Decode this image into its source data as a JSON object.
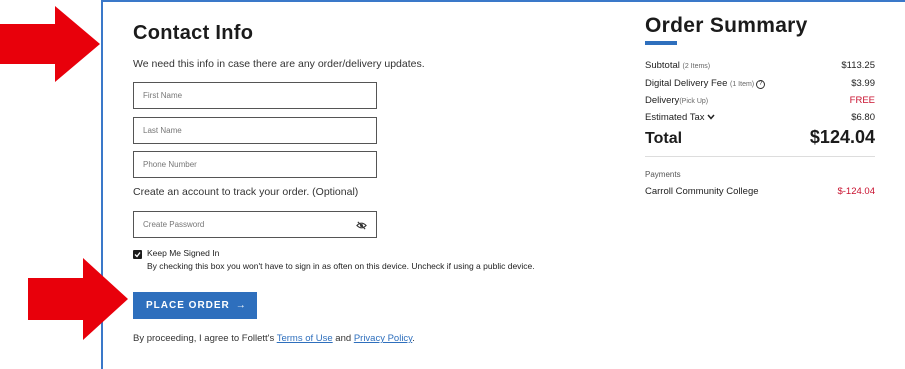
{
  "contact": {
    "title": "Contact Info",
    "subtitle": "We need this info in case there are any order/delivery updates.",
    "first_name_placeholder": "First Name",
    "last_name_placeholder": "Last Name",
    "phone_placeholder": "Phone Number",
    "create_account_text": "Create an account to track your order. (Optional)",
    "password_placeholder": "Create Password",
    "keep_signed_in_label": "Keep Me Signed In",
    "keep_signed_in_desc": "By checking this box you won't have to sign in as often on this device. Uncheck if using a public device.",
    "place_order_label": "PLACE ORDER",
    "place_order_arrow": "→",
    "agree_prefix": "By proceeding, I agree to Follett's ",
    "terms_link": "Terms of Use",
    "agree_and": " and ",
    "privacy_link": "Privacy Policy",
    "agree_suffix": "."
  },
  "summary": {
    "title": "Order Summary",
    "subtotal_label": "Subtotal",
    "subtotal_note": "(2 Items)",
    "subtotal_value": "$113.25",
    "digital_label": "Digital Delivery Fee",
    "digital_note": "(1 Item)",
    "digital_value": "$3.99",
    "delivery_label": "Delivery",
    "delivery_note": "(Pick Up)",
    "delivery_value": "FREE",
    "tax_label": "Estimated Tax",
    "tax_value": "$6.80",
    "total_label": "Total",
    "total_value": "$124.04",
    "payments_label": "Payments",
    "payment_name": "Carroll Community College",
    "payment_amount": "$-124.04"
  },
  "colors": {
    "accent": "#2e6fbd",
    "arrow_red": "#e8000b",
    "negative": "#c8102e"
  },
  "icons": [
    "eye-slash-icon",
    "info-icon",
    "chevron-down-icon",
    "checkmark-icon",
    "arrow-right-icon"
  ]
}
